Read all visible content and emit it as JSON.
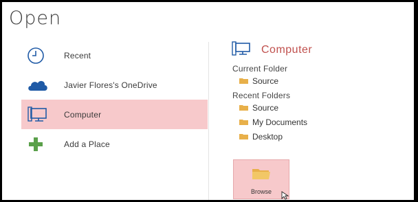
{
  "title": "Open",
  "places": [
    {
      "label": "Recent",
      "icon": "clock-icon",
      "selected": false
    },
    {
      "label": "Javier Flores's OneDrive",
      "icon": "cloud-icon",
      "selected": false
    },
    {
      "label": "Computer",
      "icon": "computer-icon",
      "selected": true
    },
    {
      "label": "Add a Place",
      "icon": "plus-icon",
      "selected": false
    }
  ],
  "right_panel": {
    "heading": "Computer",
    "heading_icon": "computer-icon",
    "current_folder_title": "Current Folder",
    "current_folders": [
      "Source"
    ],
    "recent_folders_title": "Recent Folders",
    "recent_folders": [
      "Source",
      "My Documents",
      "Desktop"
    ],
    "browse_label": "Browse"
  },
  "colors": {
    "accent": "#c0504d",
    "selected_bg": "#f7c9cb",
    "cloud": "#1f5aa6",
    "plus": "#5aa04a",
    "folder": "#e8b04a"
  }
}
